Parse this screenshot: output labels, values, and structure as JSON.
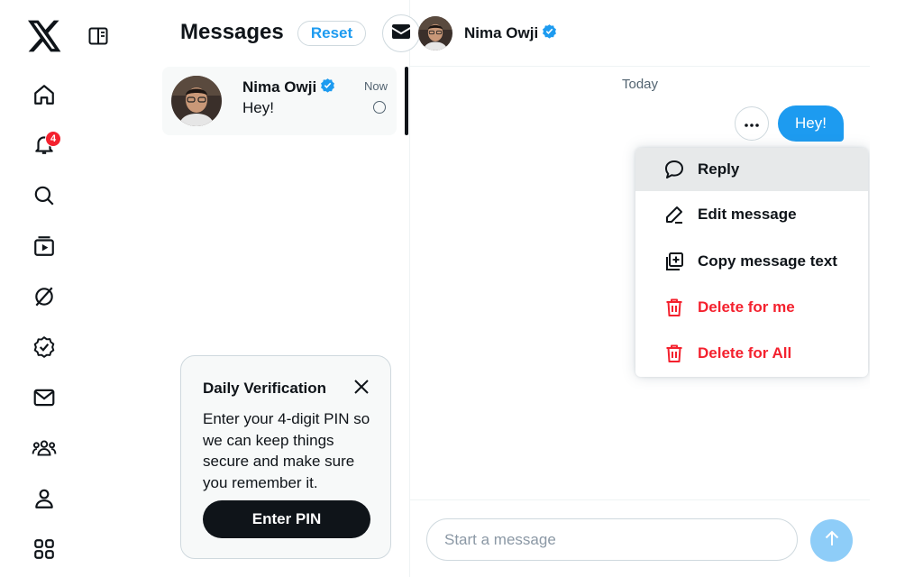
{
  "nav": {
    "logo_icon": "x-logo-icon",
    "collapse_icon": "sidebar-collapse-icon",
    "items": [
      {
        "name": "home",
        "icon": "home-icon"
      },
      {
        "name": "notifications",
        "icon": "bell-icon",
        "badge": "4"
      },
      {
        "name": "explore",
        "icon": "search-icon"
      },
      {
        "name": "video",
        "icon": "video-icon"
      },
      {
        "name": "grok",
        "icon": "grok-icon"
      },
      {
        "name": "verified",
        "icon": "verified-badge-icon"
      },
      {
        "name": "messages",
        "icon": "mail-icon"
      },
      {
        "name": "communities",
        "icon": "communities-icon"
      },
      {
        "name": "profile",
        "icon": "person-icon"
      },
      {
        "name": "more",
        "icon": "grid-icon"
      }
    ]
  },
  "messages": {
    "title": "Messages",
    "reset_label": "Reset",
    "compose_icon": "envelope-icon",
    "conversations": [
      {
        "name": "Nima Owji",
        "snippet": "Hey!",
        "time": "Now"
      }
    ]
  },
  "verification": {
    "title": "Daily Verification",
    "body": "Enter your 4-digit PIN so we can keep things secure and make sure you remember it.",
    "button_label": "Enter PIN"
  },
  "chat": {
    "contact_name": "Nima Owji",
    "day_separator": "Today",
    "messages": [
      {
        "text": "Hey!",
        "outgoing": true
      }
    ],
    "menu": [
      {
        "label": "Reply",
        "icon": "reply-bubble-icon",
        "danger": false
      },
      {
        "label": "Edit message",
        "icon": "pencil-icon",
        "danger": false
      },
      {
        "label": "Copy message text",
        "icon": "copy-icon",
        "danger": false
      },
      {
        "label": "Delete for me",
        "icon": "trash-icon",
        "danger": true
      },
      {
        "label": "Delete for All",
        "icon": "trash-icon",
        "danger": true
      }
    ],
    "composer_placeholder": "Start a message"
  },
  "colors": {
    "accent": "#1d9bf0",
    "danger": "#f4212e",
    "text": "#0f1419",
    "muted": "#536471"
  }
}
